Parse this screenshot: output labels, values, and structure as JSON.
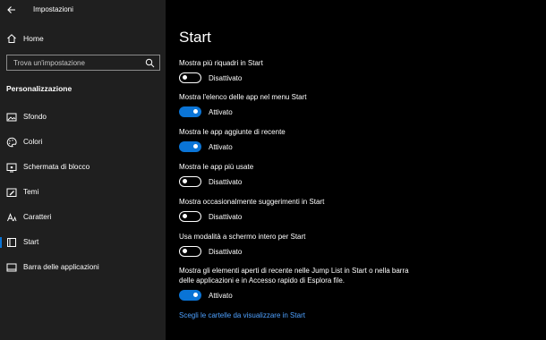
{
  "window": {
    "title": "Impostazioni"
  },
  "sidebar": {
    "home_label": "Home",
    "search_placeholder": "Trova un'impostazione",
    "section_title": "Personalizzazione",
    "items": [
      {
        "label": "Sfondo",
        "icon": "image-icon"
      },
      {
        "label": "Colori",
        "icon": "palette-icon"
      },
      {
        "label": "Schermata di blocco",
        "icon": "lock-screen-icon"
      },
      {
        "label": "Temi",
        "icon": "brush-icon"
      },
      {
        "label": "Caratteri",
        "icon": "font-icon"
      },
      {
        "label": "Start",
        "icon": "start-icon",
        "selected": true
      },
      {
        "label": "Barra delle applicazioni",
        "icon": "taskbar-icon"
      }
    ]
  },
  "main": {
    "title": "Start",
    "settings": [
      {
        "label": "Mostra più riquadri in Start",
        "state": "Disattivato",
        "on": false
      },
      {
        "label": "Mostra l'elenco delle app nel menu Start",
        "state": "Attivato",
        "on": true
      },
      {
        "label": "Mostra le app aggiunte di recente",
        "state": "Attivato",
        "on": true
      },
      {
        "label": "Mostra le app più usate",
        "state": "Disattivato",
        "on": false
      },
      {
        "label": "Mostra occasionalmente suggerimenti in Start",
        "state": "Disattivato",
        "on": false
      },
      {
        "label": "Usa modalità a schermo intero per Start",
        "state": "Disattivato",
        "on": false
      },
      {
        "label": "Mostra gli elementi aperti di recente nelle Jump List in Start o nella barra delle applicazioni e in Accesso rapido di Esplora file.",
        "state": "Attivato",
        "on": true
      }
    ],
    "link": "Scegli le cartelle da visualizzare in Start"
  },
  "colors": {
    "accent": "#0a74d6",
    "sidebar_bg": "#1f1f1f",
    "main_bg": "#000000",
    "link": "#4ea1ff"
  }
}
